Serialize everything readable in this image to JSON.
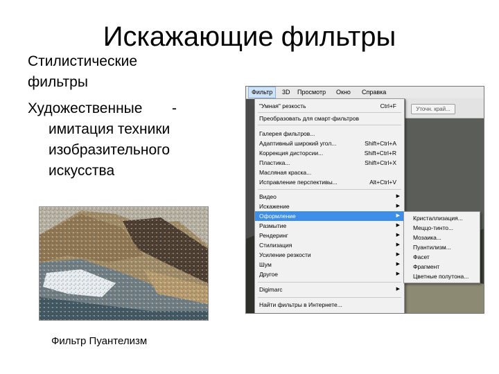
{
  "slide": {
    "title": "Искажающие фильтры",
    "subtitle": "Стилистические фильтры",
    "item_lead": "Художественные",
    "item_dash": "-",
    "item_rest": "имитация техники изобразительного искусства",
    "caption": "Фильтр Пуантелизм"
  },
  "photoshop": {
    "menubar": [
      "Фильтр",
      "3D",
      "Просмотр",
      "Окно",
      "Справка"
    ],
    "refine_button": "Уточн. край...",
    "menu_items": [
      {
        "label": "\"Умная\" резкость",
        "shortcut": "Ctrl+F"
      },
      {
        "label": "Преобразовать для смарт-фильтров",
        "shortcut": ""
      },
      {
        "label": "Галерея фильтров...",
        "shortcut": ""
      },
      {
        "label": "Адаптивный широкий угол...",
        "shortcut": "Shift+Ctrl+A"
      },
      {
        "label": "Коррекция дисторсии...",
        "shortcut": "Shift+Ctrl+R"
      },
      {
        "label": "Пластика...",
        "shortcut": "Shift+Ctrl+X"
      },
      {
        "label": "Масляная краска...",
        "shortcut": ""
      },
      {
        "label": "Исправление перспективы...",
        "shortcut": "Alt+Ctrl+V"
      },
      {
        "label": "Видео",
        "shortcut": ""
      },
      {
        "label": "Искажение",
        "shortcut": ""
      },
      {
        "label": "Оформление",
        "shortcut": ""
      },
      {
        "label": "Размытие",
        "shortcut": ""
      },
      {
        "label": "Рендеринг",
        "shortcut": ""
      },
      {
        "label": "Стилизация",
        "shortcut": ""
      },
      {
        "label": "Усиление резкости",
        "shortcut": ""
      },
      {
        "label": "Шум",
        "shortcut": ""
      },
      {
        "label": "Другое",
        "shortcut": ""
      },
      {
        "label": "Digimarc",
        "shortcut": ""
      },
      {
        "label": "Найти фильтры в Интернете...",
        "shortcut": ""
      }
    ],
    "submenu_items": [
      "Кристаллизация...",
      "Меццо-тинто...",
      "Мозаика...",
      "Пуантилизм...",
      "Фасет",
      "Фрагмент",
      "Цветные полутона..."
    ],
    "highlight_color": "#3d8ee6"
  }
}
